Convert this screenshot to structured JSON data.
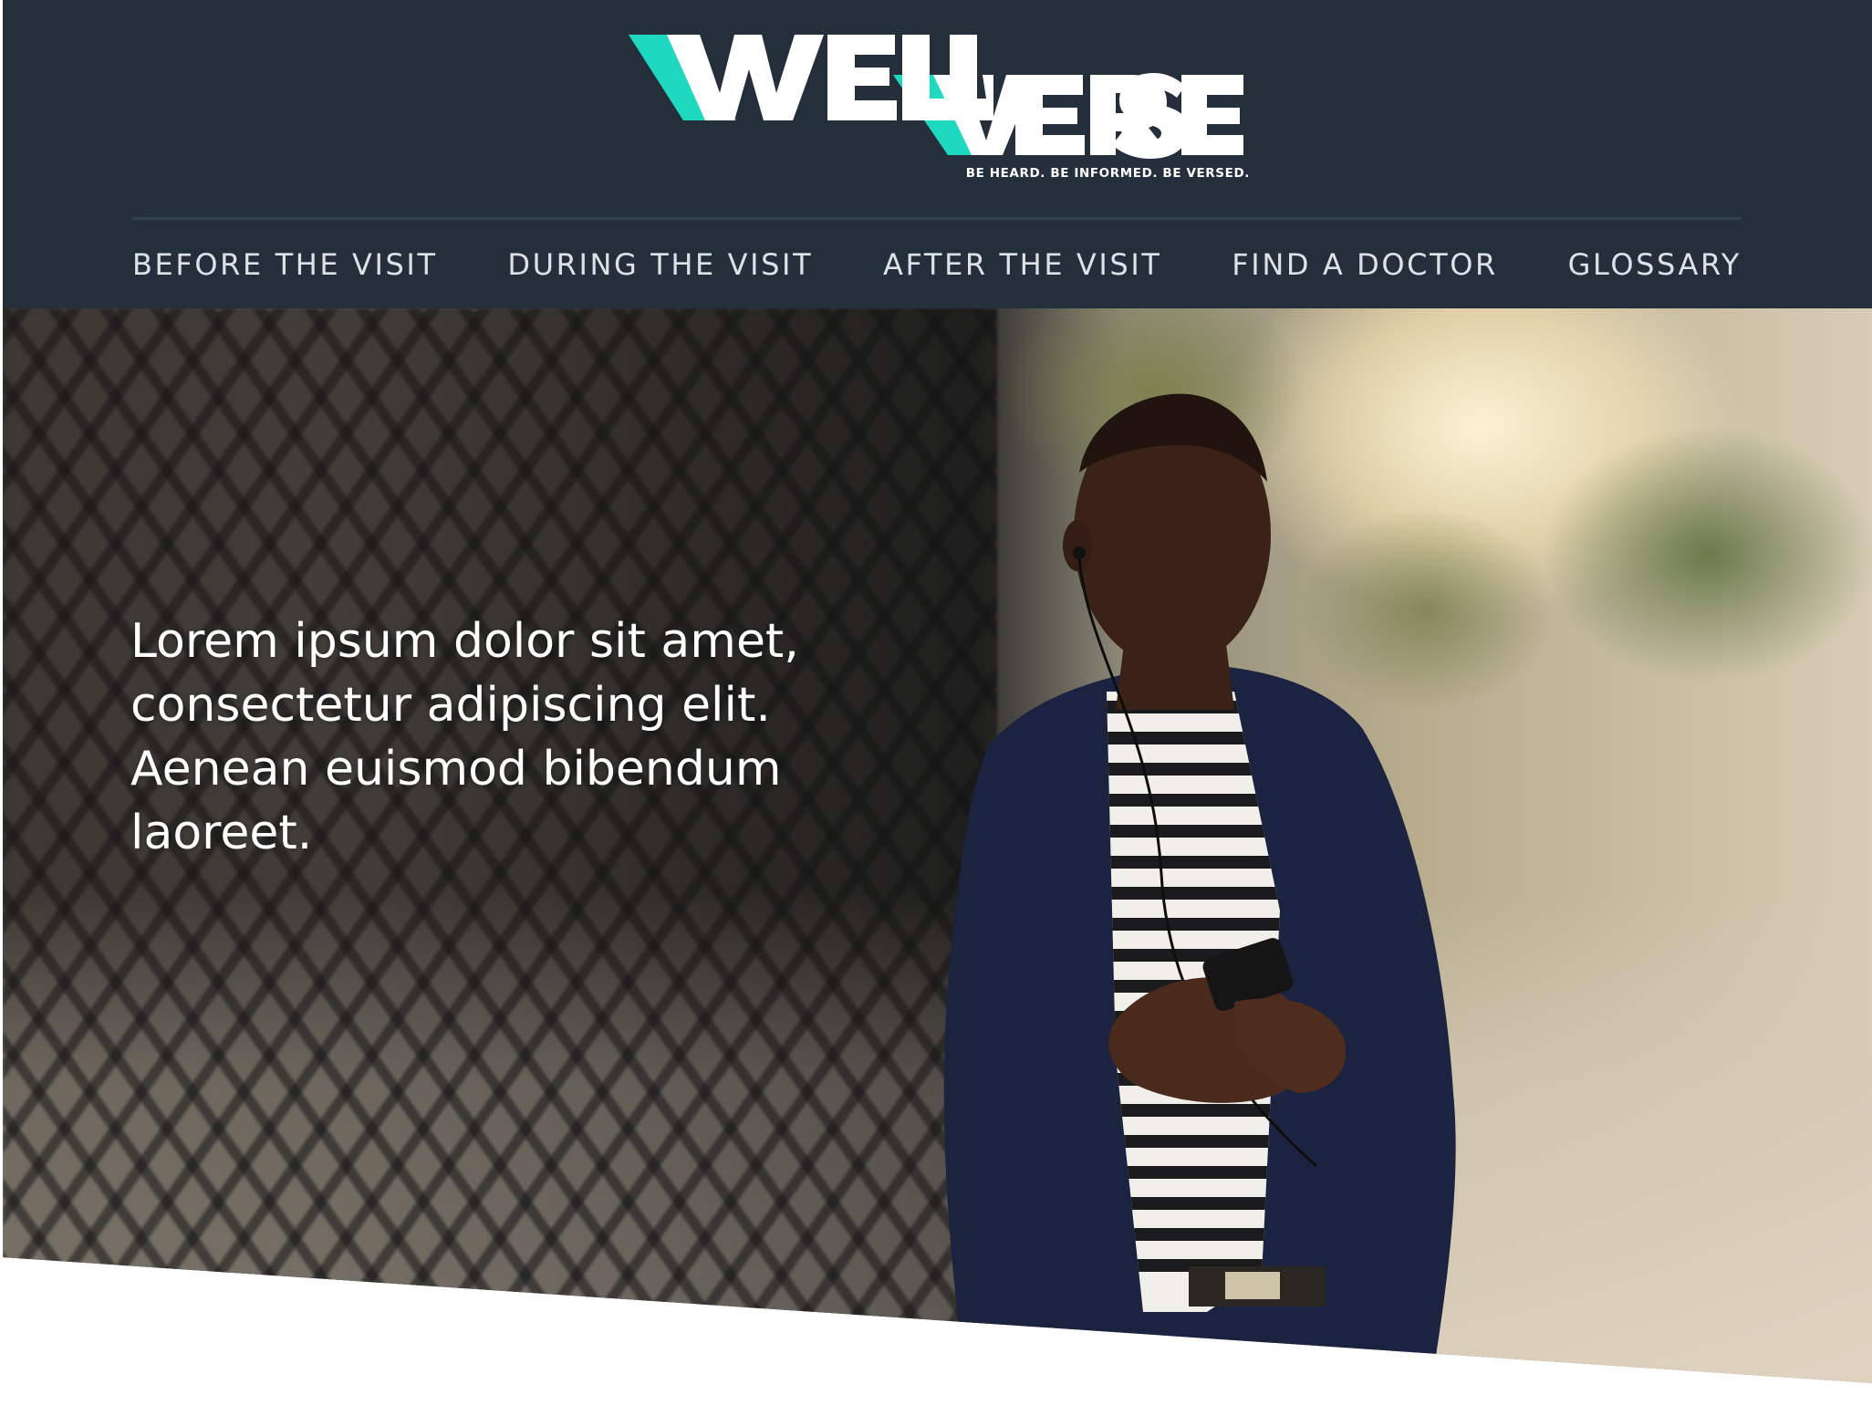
{
  "brand": {
    "logo_text": "WELLVERSED",
    "tagline": "BE HEARD. BE INFORMED. BE VERSED.",
    "colors": {
      "header_bg": "#252f3c",
      "accent_teal": "#1ed9c0",
      "logo_white": "#ffffff"
    }
  },
  "nav": {
    "items": [
      {
        "label": "BEFORE THE VISIT"
      },
      {
        "label": "DURING THE VISIT"
      },
      {
        "label": "AFTER THE VISIT"
      },
      {
        "label": "FIND A DOCTOR"
      },
      {
        "label": "GLOSSARY"
      }
    ]
  },
  "hero": {
    "headline": "Lorem ipsum dolor sit amet, consectetur adipiscing elit. Aenean euismod bibendum laoreet.",
    "image_icon": "photo-man-with-phone"
  }
}
